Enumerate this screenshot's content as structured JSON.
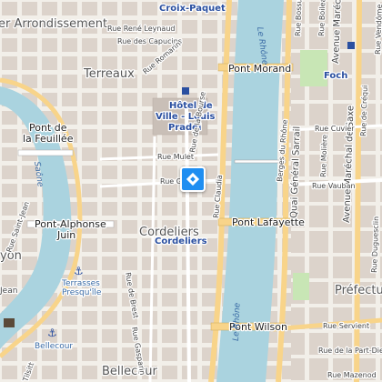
{
  "map": {
    "districts": {
      "arrondissement": "er Arrondissement",
      "terreaux": "Terreaux",
      "cordeliers": "Cordeliers",
      "bellecour": "Bellecour",
      "prefecture": "Préfectu",
      "lyon": "yon",
      "jean": "Jean"
    },
    "landmarks": {
      "croix_paquet": "Croix-Paquet",
      "hotel_de_ville_1": "Hôtel de",
      "hotel_de_ville_2": "Ville - Louis",
      "hotel_de_ville_3": "Pradel",
      "cordeliers_station": "Cordeliers",
      "foch": "Foch",
      "terrasses_1": "Terrasses",
      "terrasses_2": "Presqu'île",
      "bellecour_station": "Bellecour"
    },
    "bridges": {
      "morand": "Pont Morand",
      "lafayette": "Pont Lafayette",
      "wilson": "Pont Wilson",
      "alphonse_1": "Pont-Alphonse",
      "alphonse_2": "Juin",
      "feuillee_1": "Pont de",
      "feuillee_2": "la Feuillée"
    },
    "rivers": {
      "rhone": "Le Rhône",
      "saone": "Saône"
    },
    "streets": {
      "neyret": "Rue René Leynaud",
      "capucins": "Rue des Capucins",
      "romarin": "Rue Romarin",
      "mulet": "Rue Mulet",
      "grolee": "Rue G",
      "bourse": "Rue de la Bourse",
      "claudia": "Rue Claudia",
      "brest": "Rue de Brest",
      "gasparin": "Rue Gasparin",
      "st_jean": "Rue Saint-Jean",
      "quai_sarrail": "Quai Général Sarrail",
      "marechal_foch": "Avenue Maréchal Foch",
      "marechal_saxe": "Avenue Maréchal de Saxe",
      "cuvier": "Rue Cuvier",
      "vauban": "Rue Vauban",
      "moliere": "Rue Molière",
      "servient": "Rue Servient",
      "part_dieu": "Rue de la Part-Dieu",
      "berges": "Berges du Rhône",
      "mazenod": "Rue Mazenod",
      "tilsitt": "Tilsitt",
      "vendome": "Rue Vendôme",
      "boileau": "Rue Boileau",
      "bossuet": "Rue Bossuet",
      "crequi": "Rue de Créqui",
      "duguesclin": "Rue Duguesclin"
    },
    "marker": {
      "icon": "location-diamond-icon",
      "color": "#1f8ef1"
    },
    "colors": {
      "water": "#aad3df",
      "major_road": "#f8d48a",
      "block": "#d9d0c9",
      "land": "#f2efe9"
    }
  }
}
